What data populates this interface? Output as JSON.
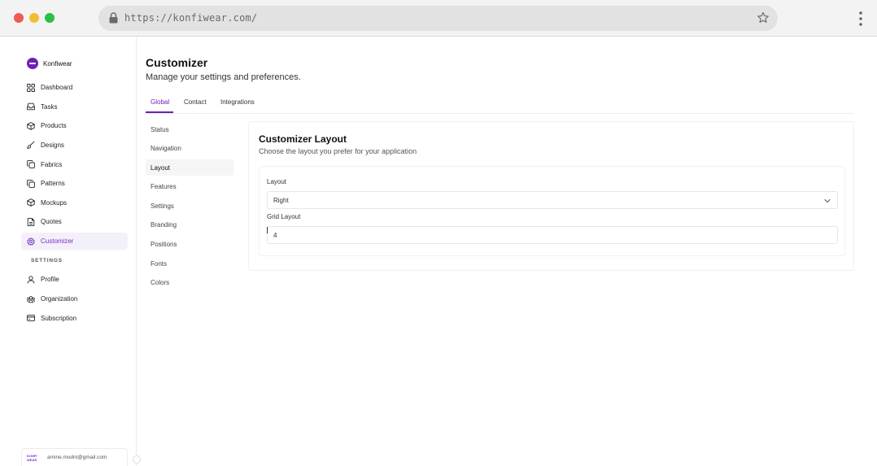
{
  "browser": {
    "url": "https://konfiwear.com/"
  },
  "sidebar": {
    "brand": "Konfiwear",
    "items": [
      {
        "label": "Dashboard",
        "icon": "grid-icon"
      },
      {
        "label": "Tasks",
        "icon": "inbox-icon"
      },
      {
        "label": "Products",
        "icon": "box-icon"
      },
      {
        "label": "Designs",
        "icon": "brush-icon"
      },
      {
        "label": "Fabrics",
        "icon": "copy-icon"
      },
      {
        "label": "Patterns",
        "icon": "copy-icon"
      },
      {
        "label": "Mockups",
        "icon": "box-icon"
      },
      {
        "label": "Quotes",
        "icon": "file-icon"
      },
      {
        "label": "Customizer",
        "icon": "gear-icon",
        "active": true
      }
    ],
    "settings_label": "SETTINGS",
    "settings_items": [
      {
        "label": "Profile",
        "icon": "user-icon"
      },
      {
        "label": "Organization",
        "icon": "users-icon"
      },
      {
        "label": "Subscription",
        "icon": "card-icon"
      }
    ],
    "user": {
      "avatar_text": "KONFI WEAR",
      "email": "amine.modni@gmail.com"
    }
  },
  "main": {
    "title": "Customizer",
    "subtitle": "Manage your settings and preferences.",
    "tabs": [
      {
        "label": "Global",
        "active": true
      },
      {
        "label": "Contact"
      },
      {
        "label": "Integrations"
      }
    ],
    "subnav": [
      {
        "label": "Status"
      },
      {
        "label": "Navigation"
      },
      {
        "label": "Layout",
        "active": true
      },
      {
        "label": "Features"
      },
      {
        "label": "Settings"
      },
      {
        "label": "Branding"
      },
      {
        "label": "Positions"
      },
      {
        "label": "Fonts"
      },
      {
        "label": "Colors"
      }
    ],
    "card": {
      "title": "Customizer Layout",
      "description": "Choose the layout you prefer for your application",
      "layout_label": "Layout",
      "layout_value": "Right",
      "grid_label": "Grid Layout",
      "grid_value": "4"
    }
  },
  "colors": {
    "accent": "#6d1fb8",
    "active_bg": "#f4f0fa"
  }
}
